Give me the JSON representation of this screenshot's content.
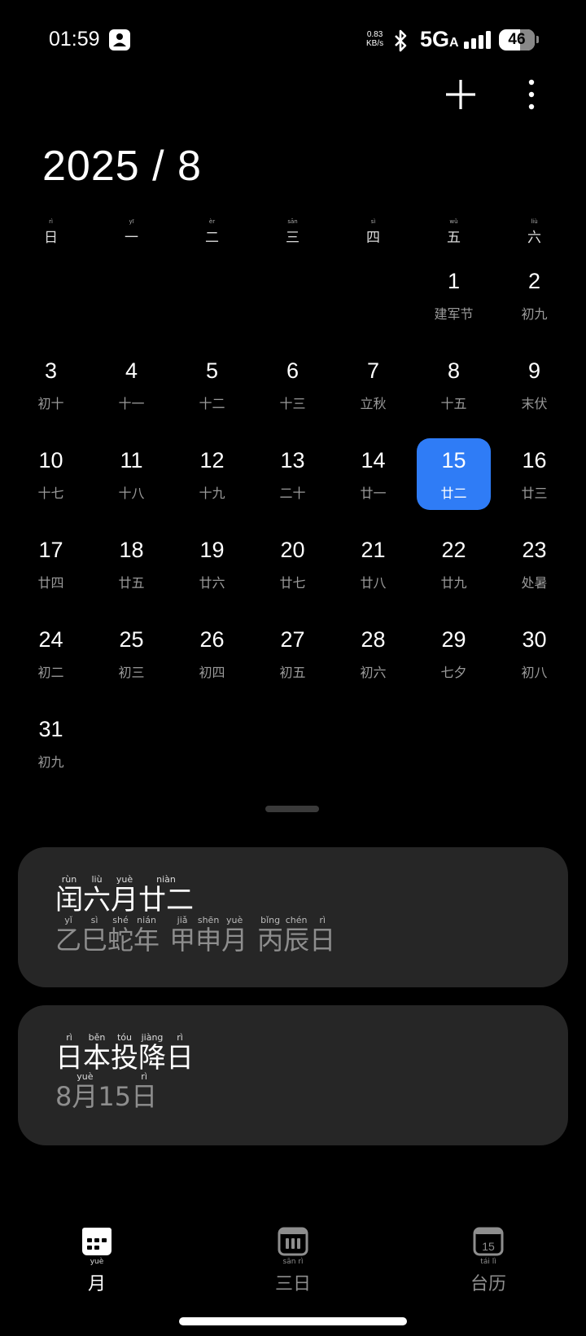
{
  "status_bar": {
    "time": "01:59",
    "net_speed_value": "0.83",
    "net_speed_unit": "KB/s",
    "network": "5G",
    "network_sub": "A",
    "battery": "46"
  },
  "header": {
    "title": "2025 / 8"
  },
  "weekdays": [
    {
      "label": "日",
      "py": "rì"
    },
    {
      "label": "一",
      "py": "yī"
    },
    {
      "label": "二",
      "py": "èr"
    },
    {
      "label": "三",
      "py": "sān"
    },
    {
      "label": "四",
      "py": "sì"
    },
    {
      "label": "五",
      "py": "wǔ"
    },
    {
      "label": "六",
      "py": "liù"
    }
  ],
  "weeks": [
    [
      null,
      null,
      null,
      null,
      null,
      {
        "day": "1",
        "lunar": "建军节"
      },
      {
        "day": "2",
        "lunar": "初九"
      }
    ],
    [
      {
        "day": "3",
        "lunar": "初十"
      },
      {
        "day": "4",
        "lunar": "十一"
      },
      {
        "day": "5",
        "lunar": "十二"
      },
      {
        "day": "6",
        "lunar": "十三"
      },
      {
        "day": "7",
        "lunar": "立秋"
      },
      {
        "day": "8",
        "lunar": "十五"
      },
      {
        "day": "9",
        "lunar": "末伏"
      }
    ],
    [
      {
        "day": "10",
        "lunar": "十七"
      },
      {
        "day": "11",
        "lunar": "十八"
      },
      {
        "day": "12",
        "lunar": "十九"
      },
      {
        "day": "13",
        "lunar": "二十"
      },
      {
        "day": "14",
        "lunar": "廿一"
      },
      {
        "day": "15",
        "lunar": "廿二",
        "selected": true
      },
      {
        "day": "16",
        "lunar": "廿三"
      }
    ],
    [
      {
        "day": "17",
        "lunar": "廿四"
      },
      {
        "day": "18",
        "lunar": "廿五"
      },
      {
        "day": "19",
        "lunar": "廿六"
      },
      {
        "day": "20",
        "lunar": "廿七"
      },
      {
        "day": "21",
        "lunar": "廿八"
      },
      {
        "day": "22",
        "lunar": "廿九"
      },
      {
        "day": "23",
        "lunar": "处暑"
      }
    ],
    [
      {
        "day": "24",
        "lunar": "初二"
      },
      {
        "day": "25",
        "lunar": "初三"
      },
      {
        "day": "26",
        "lunar": "初四"
      },
      {
        "day": "27",
        "lunar": "初五"
      },
      {
        "day": "28",
        "lunar": "初六"
      },
      {
        "day": "29",
        "lunar": "七夕"
      },
      {
        "day": "30",
        "lunar": "初八"
      }
    ],
    [
      {
        "day": "31",
        "lunar": "初九"
      },
      null,
      null,
      null,
      null,
      null,
      null
    ]
  ],
  "lunar_card": {
    "line1": [
      {
        "ch": "闰",
        "py": "rùn"
      },
      {
        "ch": "六",
        "py": "liù"
      },
      {
        "ch": "月",
        "py": "yuè"
      },
      {
        "ch": "廿二",
        "py": "niàn"
      }
    ],
    "line2": [
      {
        "ch": "乙",
        "py": "yǐ"
      },
      {
        "ch": "巳",
        "py": "sì"
      },
      {
        "ch": "蛇",
        "py": "shé"
      },
      {
        "ch": "年",
        "py": "nián"
      },
      {
        "gap": true
      },
      {
        "ch": "甲",
        "py": "jiǎ"
      },
      {
        "ch": "申",
        "py": "shēn"
      },
      {
        "ch": "月",
        "py": "yuè"
      },
      {
        "gap": true
      },
      {
        "ch": "丙",
        "py": "bǐng"
      },
      {
        "ch": "辰",
        "py": "chén"
      },
      {
        "ch": "日",
        "py": "rì"
      }
    ]
  },
  "holiday_card": {
    "line1": [
      {
        "ch": "日",
        "py": "rì"
      },
      {
        "ch": "本",
        "py": "běn"
      },
      {
        "ch": "投",
        "py": "tóu"
      },
      {
        "ch": "降",
        "py": "jiàng"
      },
      {
        "ch": "日",
        "py": "rì"
      }
    ],
    "line2": [
      {
        "ch": "8",
        "py": ""
      },
      {
        "ch": "月",
        "py": "yuè"
      },
      {
        "ch": "15",
        "py": ""
      },
      {
        "ch": "日",
        "py": "rì"
      }
    ]
  },
  "bottom_nav": [
    {
      "label": "月",
      "py": "yuè",
      "icon": "calendar-month-icon",
      "active": true
    },
    {
      "label": "三日",
      "py": "sān rì",
      "icon": "calendar-three-day-icon",
      "active": false
    },
    {
      "label": "台历",
      "py": "tái lì",
      "icon": "calendar-agenda-icon",
      "icon_text": "15",
      "active": false
    }
  ],
  "colors": {
    "accent": "#2f7cf6",
    "card_bg": "#262626",
    "muted": "#8e8e8e"
  }
}
